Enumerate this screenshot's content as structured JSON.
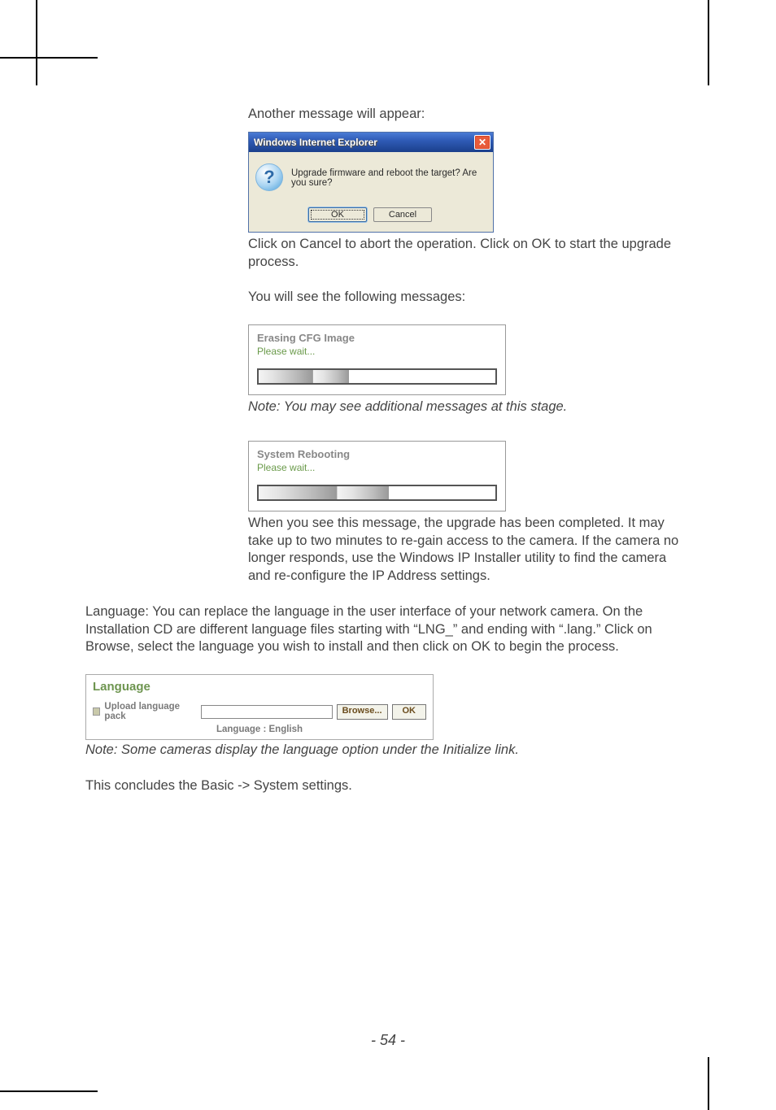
{
  "intro": "Another message will appear:",
  "dialog": {
    "title": "Windows Internet Explorer",
    "close_glyph": "✕",
    "question_glyph": "?",
    "message": "Upgrade firmware and reboot the target? Are you sure?",
    "ok_label": "OK",
    "cancel_label": "Cancel"
  },
  "after_dialog": "Click on Cancel to abort the operation. Click on OK to start the upgrade process.",
  "see_msgs": "You will see the following messages:",
  "progress1": {
    "title": "Erasing CFG Image",
    "wait": "Please wait..."
  },
  "note1": "Note: You  may see additional messages at this stage.",
  "progress2": {
    "title": "System Rebooting",
    "wait": "Please wait..."
  },
  "after_prog2": "When you see this message, the upgrade has been completed. It may take up to two minutes to re-gain access to the camera. If the camera no longer responds, use the Windows IP Installer utility to find the camera and re-configure the IP Address settings.",
  "language_para": "Language: You can replace the language in the user interface of your network camera. On the Installation CD are different language files starting with “LNG_” and ending with “.lang.” Click on Browse, select the language you wish to install and then click on OK to begin the process.",
  "lang_box": {
    "heading": "Language",
    "upload_label": "Upload language pack",
    "browse_label": "Browse...",
    "ok_label": "OK",
    "current": "Language : English"
  },
  "note2": "Note: Some cameras display the language option under the Initialize link.",
  "concludes": "This concludes the Basic -> System settings.",
  "page_number": "- 54 -"
}
